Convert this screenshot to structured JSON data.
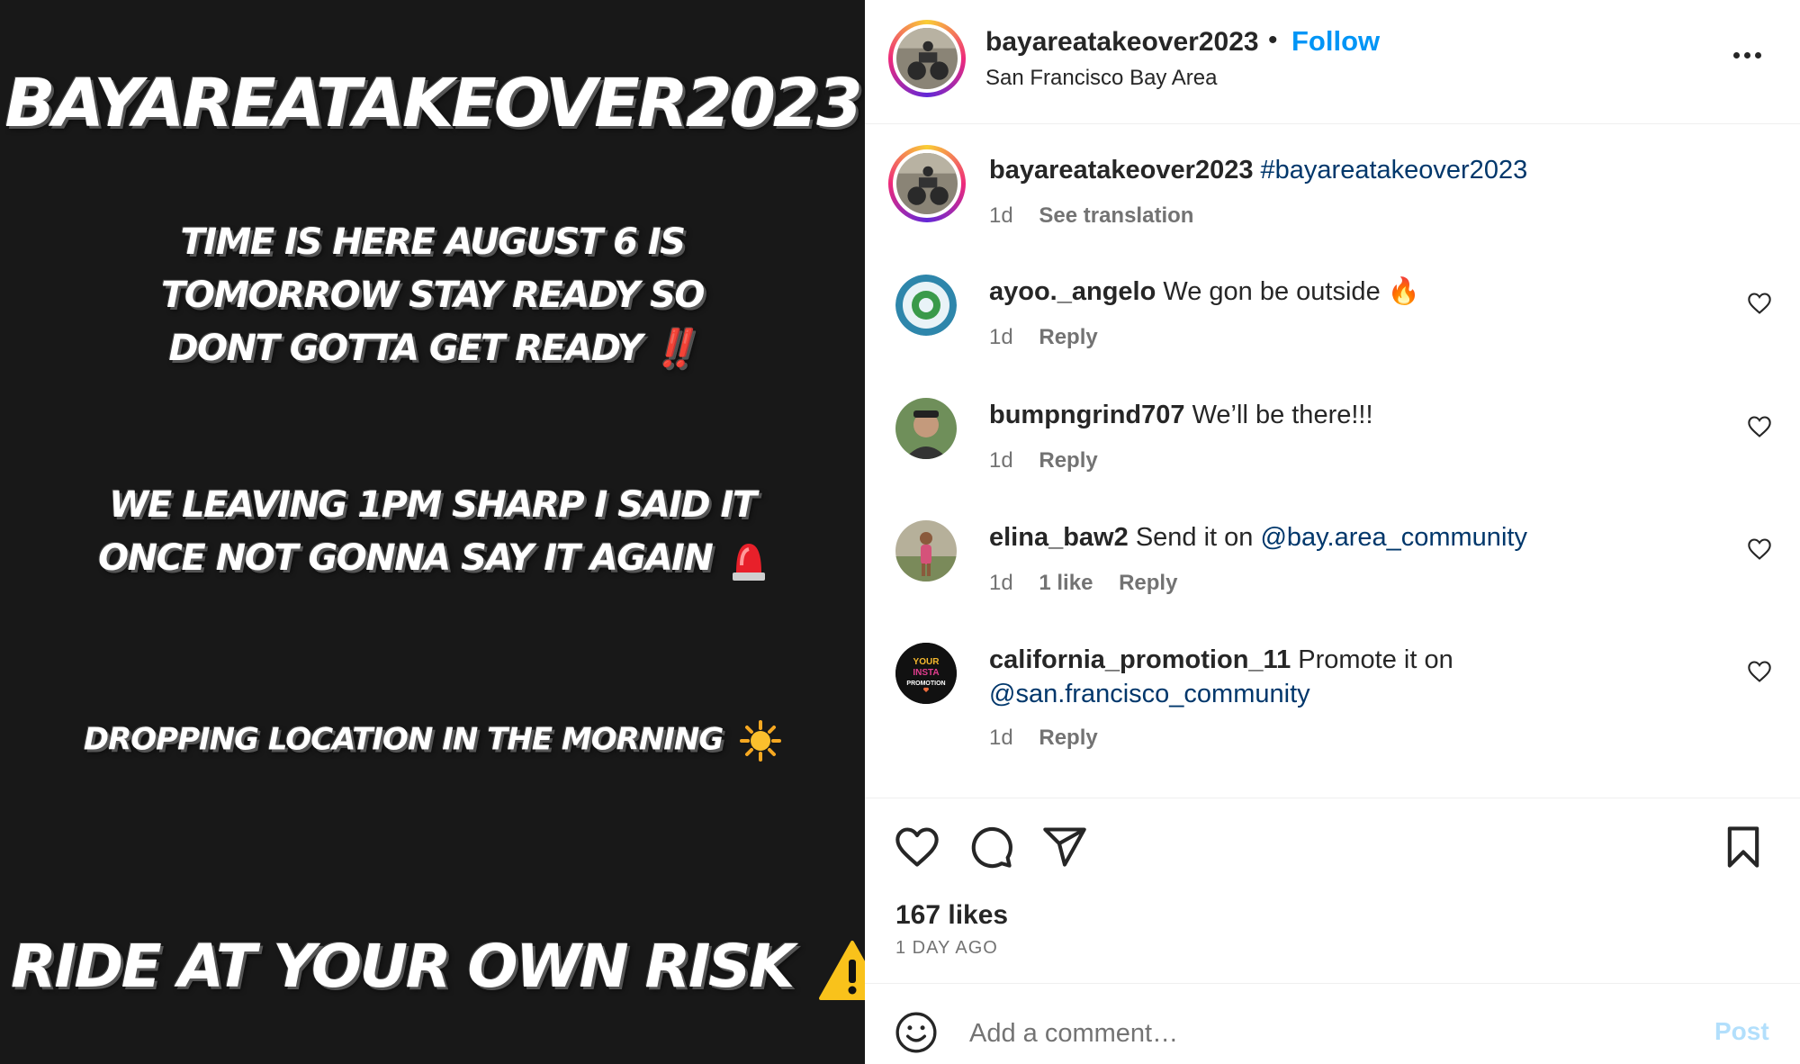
{
  "image": {
    "title": "BAYAREATAKEOVER2023",
    "line1": [
      "TIME IS HERE AUGUST 6 IS",
      "TOMORROW STAY READY SO",
      "DONT GOTTA GET READY ‼️"
    ],
    "line2": [
      "WE LEAVING 1PM SHARP I SAID IT",
      "ONCE NOT GONNA SAY IT AGAIN"
    ],
    "line3": "DROPPING LOCATION IN THE MORNING",
    "line4": "RIDE AT YOUR OWN RISK",
    "line1_end": "‼",
    "line2_emoji": "🚨",
    "line3_emoji": "☀",
    "line4_emoji": "⚠"
  },
  "header": {
    "username": "bayareatakeover2023",
    "dot": "•",
    "follow_label": "Follow",
    "location": "San Francisco Bay Area"
  },
  "caption": {
    "username": "bayareatakeover2023",
    "hashtag": "#bayareatakeover2023",
    "time": "1d",
    "translation_label": "See translation"
  },
  "comments": [
    {
      "username": "ayoo._angelo",
      "text": "We gon be outside 🔥",
      "time": "1d",
      "likes": "",
      "reply": "Reply"
    },
    {
      "username": "bumpngrind707",
      "text": "We’ll be there!!!",
      "time": "1d",
      "likes": "",
      "reply": "Reply"
    },
    {
      "username": "elina_baw2",
      "text": "Send it on ",
      "mention": "@bay.area_community",
      "time": "1d",
      "likes": "1 like",
      "reply": "Reply"
    },
    {
      "username": "california_promotion_11",
      "text": "Promote it on",
      "mention": "@san.francisco_community",
      "time": "1d",
      "likes": "",
      "reply": "Reply"
    }
  ],
  "avatar_badge": {
    "text1": "YOUR",
    "text2": "INSTA",
    "text3": "PROMOTION"
  },
  "footer": {
    "likes": "167 likes",
    "date": "1 DAY AGO",
    "comment_placeholder": "Add a comment…",
    "post_label": "Post"
  },
  "colors": {
    "link": "#0095f6",
    "mention": "#00376b",
    "meta": "#737373"
  }
}
